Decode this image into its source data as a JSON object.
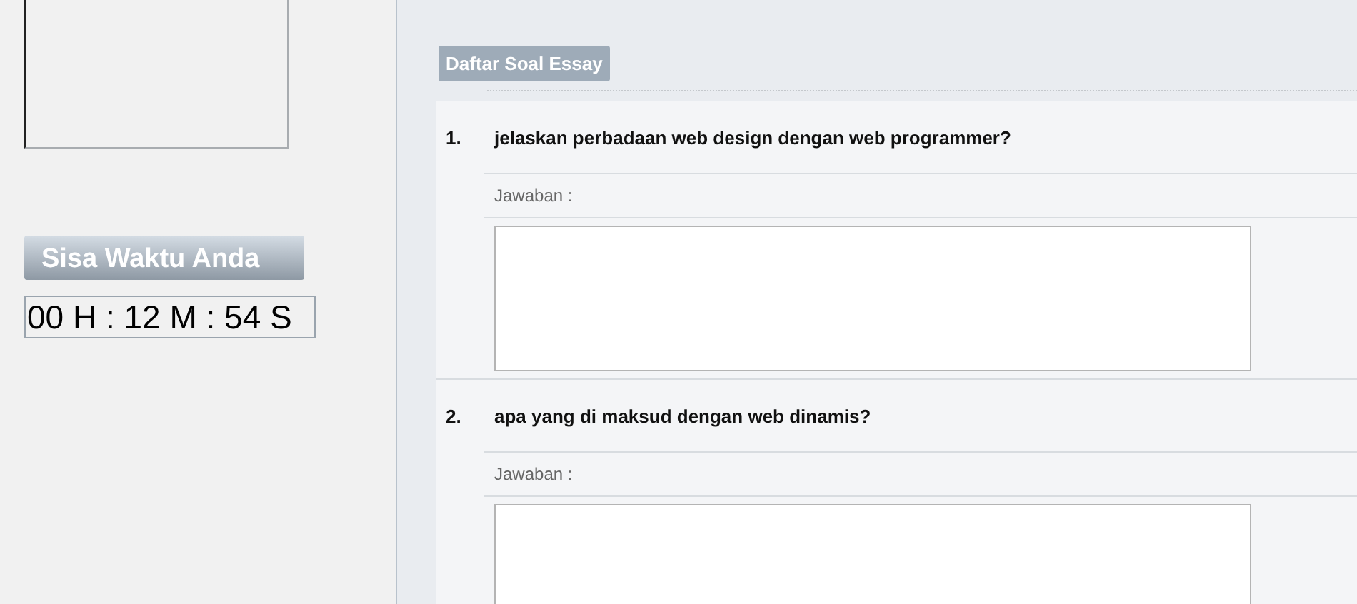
{
  "timer": {
    "label": "Sisa Waktu Anda",
    "value": "00 H : 12 M : 54 S"
  },
  "essay": {
    "heading": "Daftar Soal Essay",
    "questions": [
      {
        "number": "1.",
        "text": "jelaskan perbadaan web design dengan web programmer?",
        "answer_label": "Jawaban :"
      },
      {
        "number": "2.",
        "text": "apa yang di maksud dengan web dinamis?",
        "answer_label": "Jawaban :"
      }
    ]
  }
}
